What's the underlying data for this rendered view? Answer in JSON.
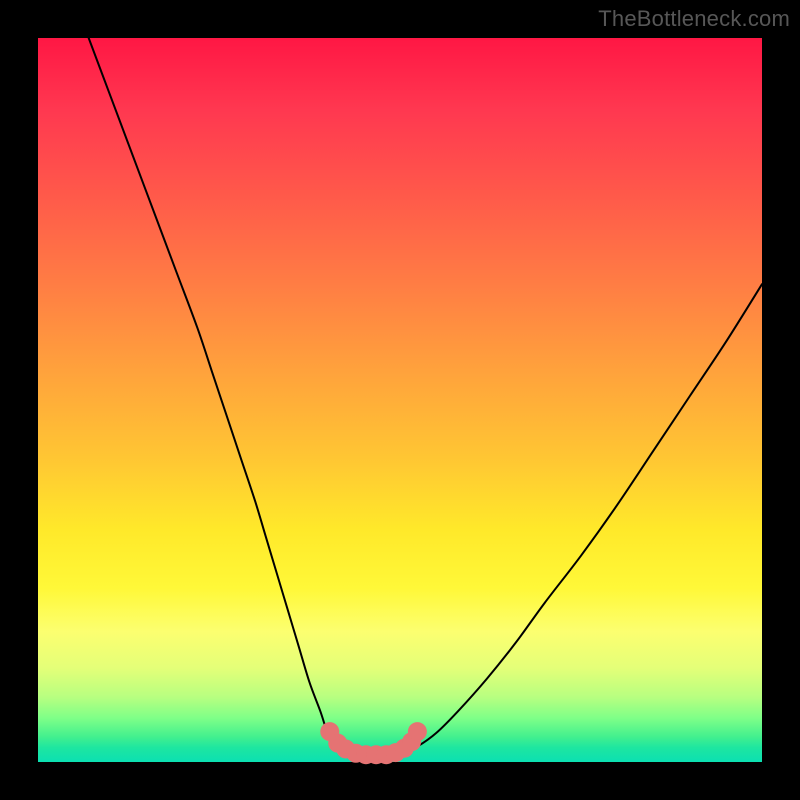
{
  "watermark": "TheBottleneck.com",
  "colors": {
    "curve_stroke": "#000000",
    "marker_fill": "#e57373",
    "marker_stroke": "#c46565"
  },
  "chart_data": {
    "type": "line",
    "title": "",
    "xlabel": "",
    "ylabel": "",
    "xlim": [
      0,
      100
    ],
    "ylim": [
      0,
      100
    ],
    "legend": false,
    "grid": false,
    "series": [
      {
        "name": "curve",
        "x": [
          7,
          10,
          13,
          16,
          19,
          22,
          24,
          26,
          28,
          30,
          31.5,
          33,
          34.5,
          36,
          37.5,
          39,
          40,
          41,
          42,
          43,
          44.5,
          46.5,
          48.5,
          50.5,
          52.5,
          55,
          58,
          62,
          66,
          70,
          75,
          80,
          85,
          90,
          95,
          100
        ],
        "y": [
          100,
          92,
          84,
          76,
          68,
          60,
          54,
          48,
          42,
          36,
          31,
          26,
          21,
          16,
          11,
          7,
          4,
          2.2,
          1.4,
          1.1,
          1.0,
          1.0,
          1.0,
          1.3,
          2.2,
          4.0,
          7.0,
          11.5,
          16.5,
          22.0,
          28.5,
          35.5,
          43.0,
          50.5,
          58.0,
          66.0
        ]
      }
    ],
    "annotations": {
      "markers": {
        "name": "bottom-cluster",
        "x": [
          40.3,
          41.4,
          42.5,
          43.9,
          45.3,
          46.7,
          48.1,
          49.4,
          50.6,
          51.6,
          52.4
        ],
        "y": [
          4.2,
          2.6,
          1.8,
          1.2,
          1.0,
          1.0,
          1.0,
          1.3,
          1.9,
          2.8,
          4.2
        ]
      }
    }
  }
}
